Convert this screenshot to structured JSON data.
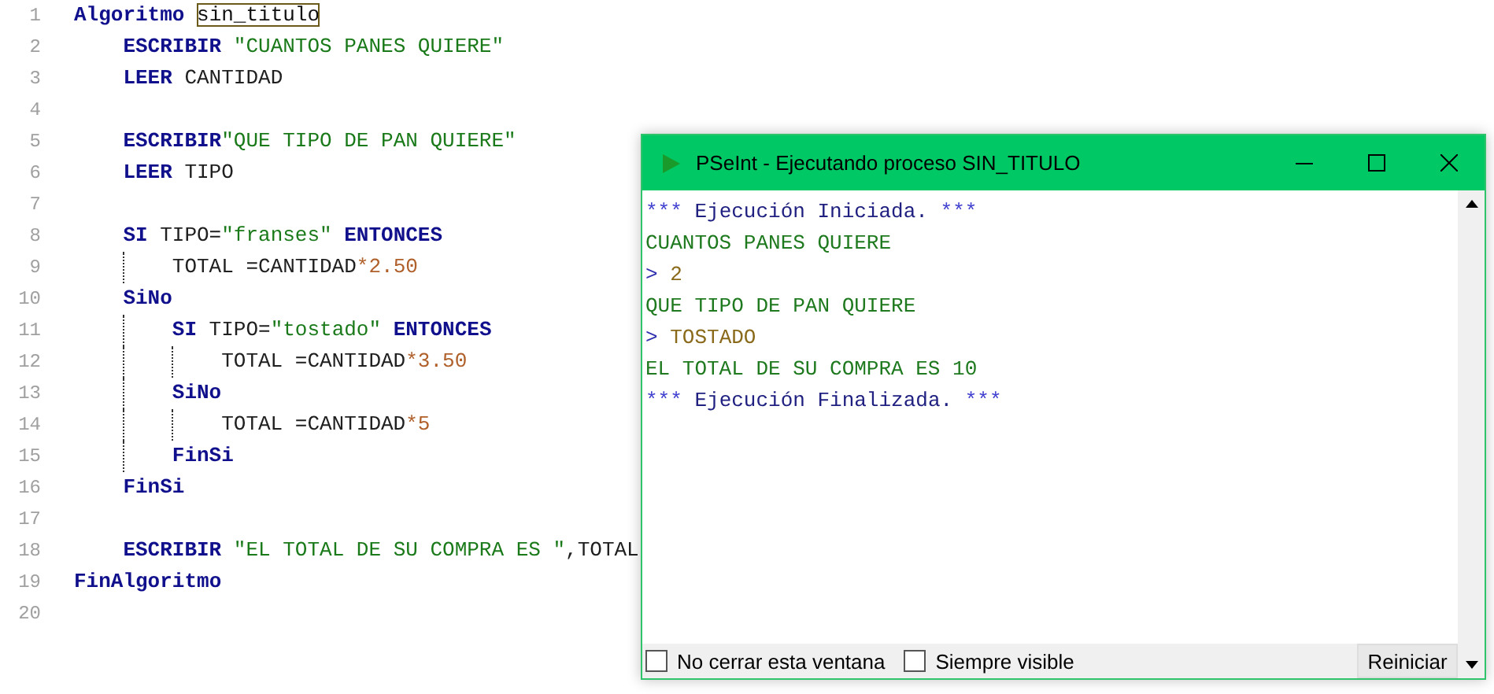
{
  "editor": {
    "lines": [
      {
        "number": "1",
        "tokens": [
          {
            "kind": "kw",
            "text": "Algoritmo "
          },
          {
            "kind": "name",
            "text": "sin_titulo"
          }
        ],
        "children": [
          {
            "number": "2",
            "tokens": [
              {
                "kind": "kw",
                "text": "ESCRIBIR"
              },
              {
                "kind": "str",
                "text": " \"CUANTOS PANES QUIERE\""
              }
            ]
          },
          {
            "number": "3",
            "tokens": [
              {
                "kind": "kw",
                "text": "LEER"
              },
              {
                "kind": "plain",
                "text": " CANTIDAD"
              }
            ]
          },
          {
            "number": "4"
          },
          {
            "number": "5",
            "tokens": [
              {
                "kind": "kw",
                "text": "ESCRIBIR"
              },
              {
                "kind": "str",
                "text": "\"QUE TIPO DE PAN QUIERE\""
              }
            ]
          },
          {
            "number": "6",
            "tokens": [
              {
                "kind": "kw",
                "text": "LEER"
              },
              {
                "kind": "plain",
                "text": " TIPO"
              }
            ]
          },
          {
            "number": "7"
          },
          {
            "number": "8",
            "tokens": [
              {
                "kind": "kw",
                "text": "SI"
              },
              {
                "kind": "plain",
                "text": " TIPO="
              },
              {
                "kind": "str",
                "text": "\"franses\""
              },
              {
                "kind": "kw",
                "text": " ENTONCES"
              }
            ],
            "children": [
              {
                "number": "9",
                "tokens": [
                  {
                    "kind": "plain",
                    "text": "TOTAL =CANTIDAD"
                  },
                  {
                    "kind": "num",
                    "text": "*2.50"
                  }
                ]
              }
            ]
          },
          {
            "number": "10",
            "tokens": [
              {
                "kind": "kw",
                "text": "SiNo"
              }
            ],
            "children": [
              {
                "number": "11",
                "tokens": [
                  {
                    "kind": "kw",
                    "text": "SI"
                  },
                  {
                    "kind": "plain",
                    "text": " TIPO="
                  },
                  {
                    "kind": "str",
                    "text": "\"tostado\""
                  },
                  {
                    "kind": "kw",
                    "text": " ENTONCES"
                  }
                ],
                "children": [
                  {
                    "number": "12",
                    "tokens": [
                      {
                        "kind": "plain",
                        "text": "TOTAL =CANTIDAD"
                      },
                      {
                        "kind": "num",
                        "text": "*3.50"
                      }
                    ]
                  }
                ]
              },
              {
                "number": "13",
                "tokens": [
                  {
                    "kind": "kw",
                    "text": "SiNo"
                  }
                ],
                "children": [
                  {
                    "number": "14",
                    "tokens": [
                      {
                        "kind": "plain",
                        "text": "TOTAL =CANTIDAD"
                      },
                      {
                        "kind": "num",
                        "text": "*5"
                      }
                    ]
                  }
                ]
              },
              {
                "number": "15",
                "tokens": [
                  {
                    "kind": "kw",
                    "text": "FinSi"
                  }
                ]
              }
            ]
          },
          {
            "number": "16",
            "tokens": [
              {
                "kind": "kw",
                "text": "FinSi"
              }
            ]
          },
          {
            "number": "17"
          },
          {
            "number": "18",
            "tokens": [
              {
                "kind": "kw",
                "text": "ESCRIBIR"
              },
              {
                "kind": "str",
                "text": " \"EL TOTAL DE SU COMPRA ES \""
              },
              {
                "kind": "plain",
                "text": ",TOTAL"
              }
            ]
          }
        ]
      },
      {
        "number": "19",
        "tokens": [
          {
            "kind": "kw",
            "text": "FinAlgoritmo"
          }
        ]
      },
      {
        "number": "20"
      }
    ]
  },
  "console_window": {
    "title": "PSeInt - Ejecutando proceso SIN_TITULO",
    "lines": [
      {
        "kind": "info",
        "text": "Ejecución Iniciada.",
        "stars": "***"
      },
      {
        "kind": "output",
        "text": "CUANTOS PANES QUIERE"
      },
      {
        "kind": "input",
        "prompt": ">",
        "text": "2"
      },
      {
        "kind": "output",
        "text": "QUE TIPO DE PAN QUIERE"
      },
      {
        "kind": "input",
        "prompt": ">",
        "text": "TOSTADO"
      },
      {
        "kind": "output",
        "text": "EL TOTAL DE SU COMPRA ES 10"
      },
      {
        "kind": "info",
        "text": "Ejecución Finalizada.",
        "stars": "***"
      }
    ],
    "options": [
      {
        "label": "No cerrar esta ventana",
        "checked": false
      },
      {
        "label": "Siempre visible",
        "checked": false
      }
    ],
    "restart_button": "Reiniciar"
  }
}
